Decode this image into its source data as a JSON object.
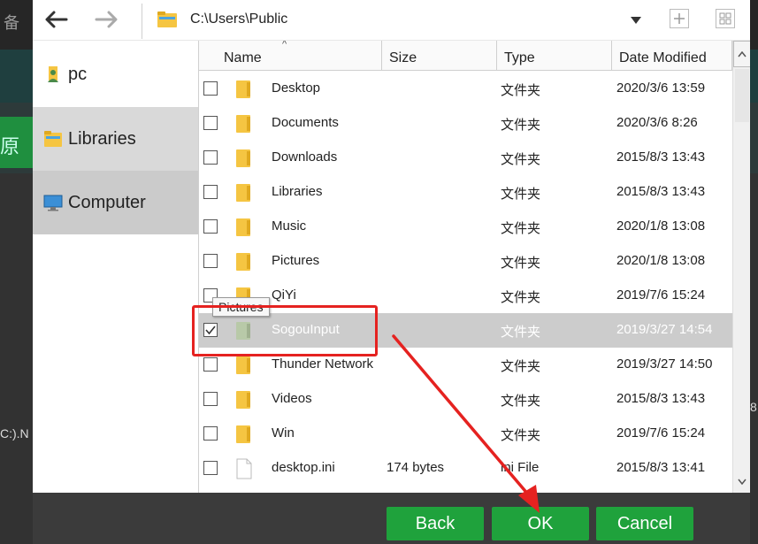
{
  "background": {
    "text_top": "备",
    "text_green": "原",
    "text_left": "C:).N",
    "text_right": "8"
  },
  "toolbar": {
    "path": "C:\\Users\\Public",
    "icons": [
      "back-arrow-icon",
      "forward-arrow-icon",
      "folder-icon",
      "chevron-down-icon",
      "new-folder-icon",
      "view-grid-icon"
    ]
  },
  "sidebar": {
    "items": [
      {
        "label": "pc",
        "icon": "pc-user-icon"
      },
      {
        "label": "Libraries",
        "icon": "libraries-folder-icon"
      },
      {
        "label": "Computer",
        "icon": "monitor-icon"
      }
    ]
  },
  "columns": {
    "name": "Name",
    "size": "Size",
    "type": "Type",
    "date": "Date Modified"
  },
  "files": [
    {
      "name": "Desktop",
      "size": "",
      "type": "文件夹",
      "date": "2020/3/6 13:59",
      "checked": false
    },
    {
      "name": "Documents",
      "size": "",
      "type": "文件夹",
      "date": "2020/3/6 8:26",
      "checked": false
    },
    {
      "name": "Downloads",
      "size": "",
      "type": "文件夹",
      "date": "2015/8/3 13:43",
      "checked": false
    },
    {
      "name": "Libraries",
      "size": "",
      "type": "文件夹",
      "date": "2015/8/3 13:43",
      "checked": false
    },
    {
      "name": "Music",
      "size": "",
      "type": "文件夹",
      "date": "2020/1/8 13:08",
      "checked": false
    },
    {
      "name": "Pictures",
      "size": "",
      "type": "文件夹",
      "date": "2020/1/8 13:08",
      "checked": false
    },
    {
      "name": "QiYi",
      "size": "",
      "type": "文件夹",
      "date": "2019/7/6 15:24",
      "checked": false
    },
    {
      "name": "SogouInput",
      "size": "",
      "type": "文件夹",
      "date": "2019/3/27 14:54",
      "checked": true
    },
    {
      "name": "Thunder Network",
      "size": "",
      "type": "文件夹",
      "date": "2019/3/27 14:50",
      "checked": false
    },
    {
      "name": "Videos",
      "size": "",
      "type": "文件夹",
      "date": "2015/8/3 13:43",
      "checked": false
    },
    {
      "name": "Win",
      "size": "",
      "type": "文件夹",
      "date": "2019/7/6 15:24",
      "checked": false
    },
    {
      "name": "desktop.ini",
      "size": "174 bytes",
      "type": "ini File",
      "date": "2015/8/3 13:41",
      "checked": false
    }
  ],
  "tooltip": "Pictures",
  "buttons": {
    "back": "Back",
    "ok": "OK",
    "cancel": "Cancel"
  },
  "colors": {
    "button_green": "#1fa23c",
    "selection_gray": "#cccccc",
    "annotation_red": "#e52220",
    "folder_yellow": "#f5c542"
  }
}
